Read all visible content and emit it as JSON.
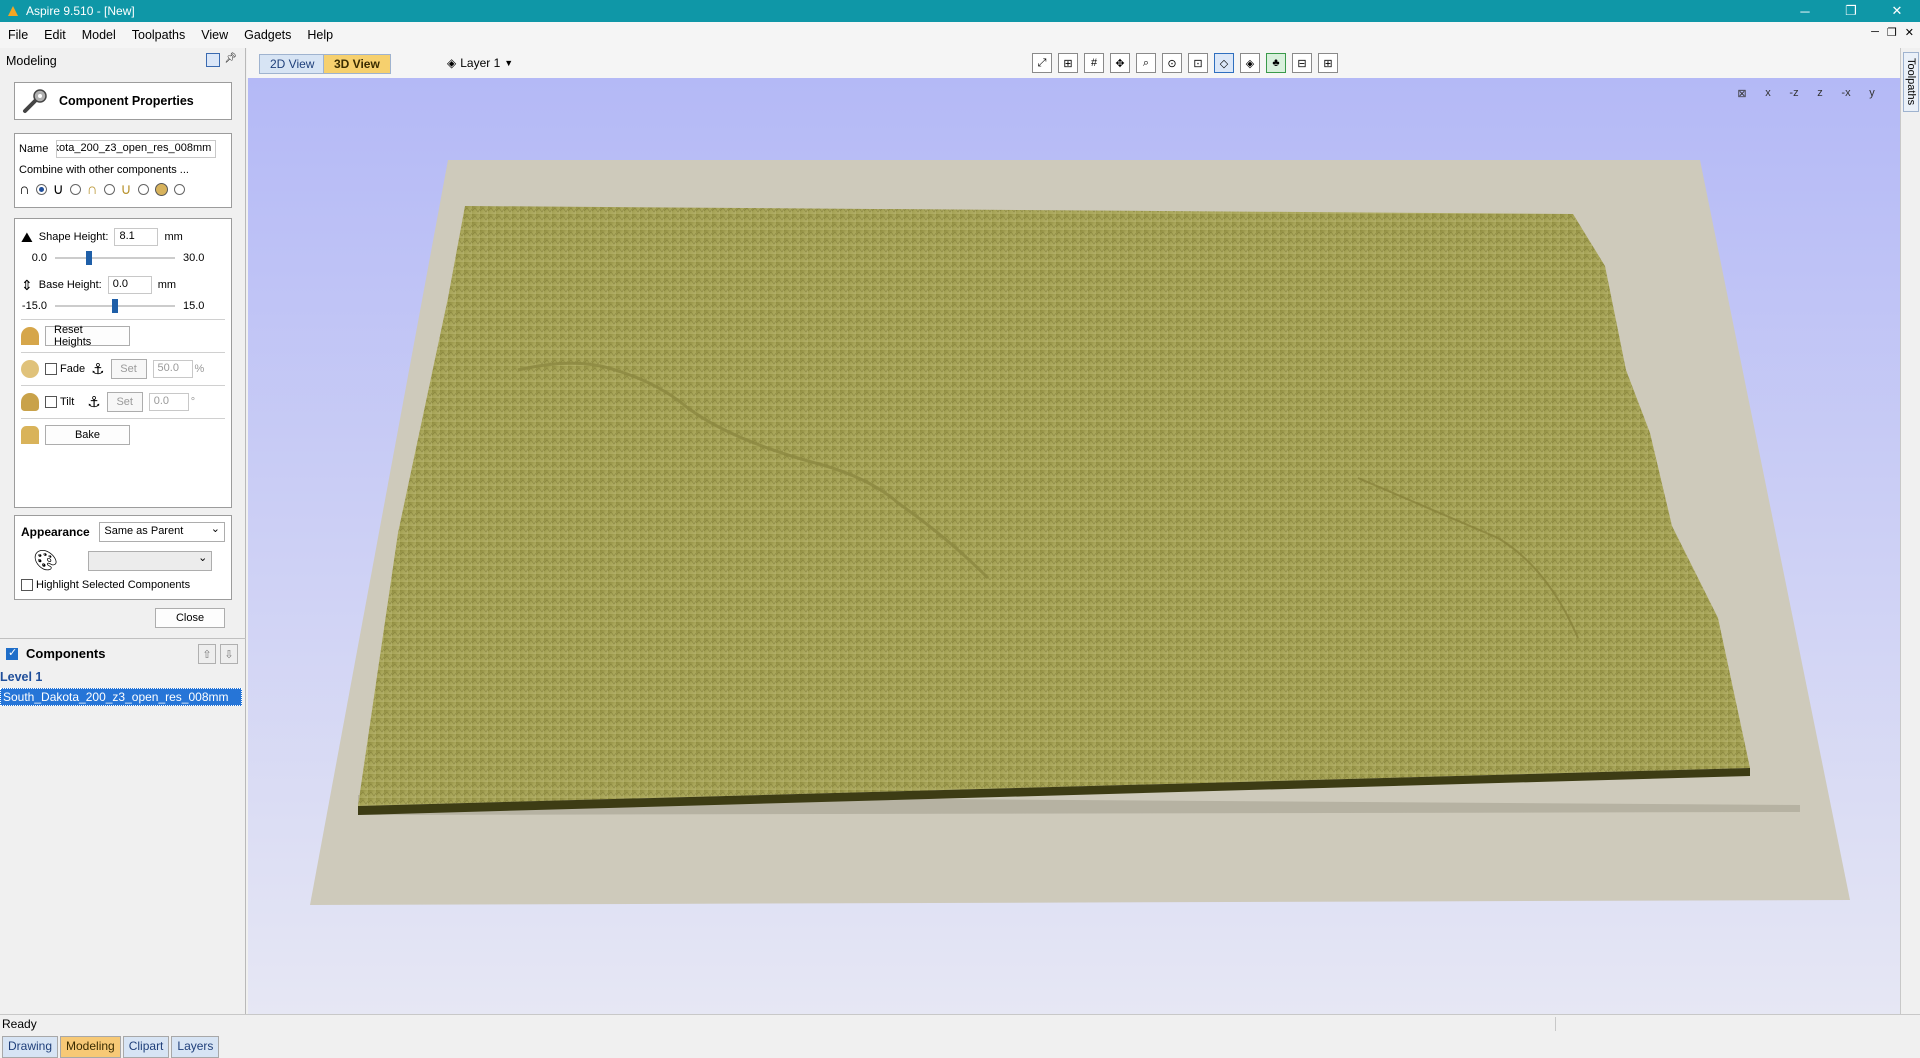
{
  "window": {
    "title": "Aspire 9.510 - [New]"
  },
  "menu": [
    "File",
    "Edit",
    "Model",
    "Toolpaths",
    "View",
    "Gadgets",
    "Help"
  ],
  "panel": {
    "title": "Modeling",
    "component_properties": "Component Properties",
    "name_label": "Name",
    "name_value": "South_Dakota_200_z3_open_res_008mm",
    "combine_label": "Combine with other components ...",
    "shape_height_label": "Shape Height:",
    "shape_height_value": "8.1",
    "shape_height_unit": "mm",
    "shape_min": "0.0",
    "shape_max": "30.0",
    "shape_height_fraction": 0.27,
    "base_height_label": "Base Height:",
    "base_height_value": "0.0",
    "base_height_unit": "mm",
    "base_min": "-15.0",
    "base_max": "15.0",
    "base_height_fraction": 0.5,
    "reset_heights": "Reset Heights",
    "fade_label": "Fade",
    "fade_set": "Set",
    "fade_value": "50.0",
    "fade_unit": "%",
    "tilt_label": "Tilt",
    "tilt_set": "Set",
    "tilt_value": "0.0",
    "tilt_unit": "°",
    "bake": "Bake",
    "appearance_label": "Appearance",
    "appearance_value": "Same as Parent",
    "highlight_label": "Highlight Selected Components",
    "close": "Close",
    "components_label": "Components",
    "tree_level": "Level 1",
    "tree_item": "South_Dakota_200_z3_open_res_008mm"
  },
  "bottom_tabs": [
    "Drawing",
    "Modeling",
    "Clipart",
    "Layers"
  ],
  "view_tabs": {
    "two_d": "2D View",
    "three_d": "3D View"
  },
  "layer": "Layer 1",
  "right_tab": "Toolpaths",
  "vp_axis": [
    "x",
    "-z",
    "z",
    "-x",
    "y"
  ],
  "status": "Ready",
  "colors": {
    "titlebar": "#0f97a7",
    "terrain": "#9d9a50",
    "viewport_top": "#b4b9f6",
    "selection": "#2675d7"
  }
}
